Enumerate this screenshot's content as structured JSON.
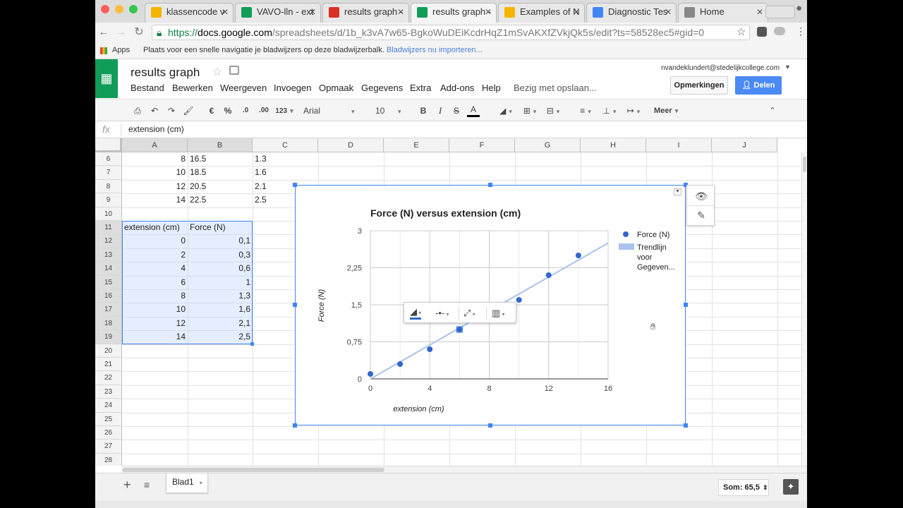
{
  "browser": {
    "tabs": [
      {
        "label": "klassencode v",
        "icon": "drive-icon",
        "color": "#f4b400"
      },
      {
        "label": "VAVO-lln - ext",
        "icon": "sheets-icon",
        "color": "#0f9d58"
      },
      {
        "label": "results graph -",
        "icon": "gmail-icon",
        "color": "#d93025"
      },
      {
        "label": "results graph -",
        "icon": "sheets-icon",
        "color": "#0f9d58"
      },
      {
        "label": "Examples of N",
        "icon": "drive-icon",
        "color": "#f4b400"
      },
      {
        "label": "Diagnostic Tes",
        "icon": "docs-icon",
        "color": "#4285f4"
      },
      {
        "label": "Home",
        "icon": "page-icon",
        "color": "#888888"
      }
    ],
    "url_prefix": "https://",
    "url_host": "docs.google.com",
    "url_path": "/spreadsheets/d/1b_k3vA7w65-BgkoWuDEiKcdrHqZ1mSvAKXfZVkjQk5s/edit?ts=58528ec5#gid=0",
    "bookmarks_apps": "Apps",
    "bookmarks_text": "Plaats voor een snelle navigatie je bladwijzers op deze bladwijzerbalk.",
    "bookmarks_link": "Bladwijzers nu importeren..."
  },
  "doc": {
    "title": "results graph",
    "menus": [
      "Bestand",
      "Bewerken",
      "Weergeven",
      "Invoegen",
      "Opmaak",
      "Gegevens",
      "Extra",
      "Add-ons",
      "Help"
    ],
    "saving_status": "Bezig met opslaan...",
    "email": "nvandeklundert@stedelijkcollege.com",
    "comments_label": "Opmerkingen",
    "share_label": "Delen"
  },
  "toolbar": {
    "currency": "€",
    "percent": "%",
    "dec_decrease": ".0",
    "dec_increase": ".00",
    "format_more": "123",
    "font": "Arial",
    "size": "10",
    "bold": "B",
    "italic": "I",
    "strike": "S",
    "text_color": "A",
    "more": "Meer"
  },
  "formula_bar": {
    "fx": "fx",
    "value": "extension (cm)"
  },
  "columns": [
    "A",
    "B",
    "C",
    "D",
    "E",
    "F",
    "G",
    "H",
    "I",
    "J"
  ],
  "rows": [
    "6",
    "7",
    "8",
    "9",
    "10",
    "11",
    "12",
    "13",
    "14",
    "15",
    "16",
    "17",
    "18",
    "19",
    "20",
    "21",
    "22",
    "23",
    "24",
    "25",
    "26",
    "27",
    "28"
  ],
  "cells_upper": [
    {
      "a": "8",
      "b": "16.5",
      "c": "1.3"
    },
    {
      "a": "10",
      "b": "18.5",
      "c": "1.6"
    },
    {
      "a": "12",
      "b": "20.5",
      "c": "2.1"
    },
    {
      "a": "14",
      "b": "22.5",
      "c": "2.5"
    }
  ],
  "table_header": {
    "a": "extension (cm)",
    "b": "Force (N)"
  },
  "table_rows": [
    {
      "a": "0",
      "b": "0,1"
    },
    {
      "a": "2",
      "b": "0,3"
    },
    {
      "a": "4",
      "b": "0,6"
    },
    {
      "a": "6",
      "b": "1"
    },
    {
      "a": "8",
      "b": "1,3"
    },
    {
      "a": "10",
      "b": "1,6"
    },
    {
      "a": "12",
      "b": "2,1"
    },
    {
      "a": "14",
      "b": "2,5"
    }
  ],
  "chart_data": {
    "type": "scatter",
    "title": "Force (N) versus extension (cm)",
    "xlabel": "extension (cm)",
    "ylabel": "Force (N)",
    "xlim": [
      0,
      16
    ],
    "ylim": [
      0,
      3
    ],
    "x_ticks": [
      "0",
      "4",
      "8",
      "12",
      "16"
    ],
    "y_ticks": [
      "0",
      "0,75",
      "1,5",
      "2,25",
      "3"
    ],
    "grid": true,
    "legend_position": "right",
    "series": [
      {
        "name": "Force (N)",
        "color": "#3366cc",
        "x": [
          0,
          2,
          4,
          6,
          8,
          10,
          12,
          14
        ],
        "y": [
          0.1,
          0.3,
          0.6,
          1.0,
          1.3,
          1.6,
          2.1,
          2.5
        ]
      }
    ],
    "trendline": {
      "name_lines": [
        "Trendlijn",
        "voor",
        "Gegeven..."
      ],
      "color": "#aac3ee",
      "x": [
        0,
        16
      ],
      "y": [
        0,
        2.75
      ]
    }
  },
  "sheet_tab": "Blad1",
  "sum_label": "Som: 65,5"
}
